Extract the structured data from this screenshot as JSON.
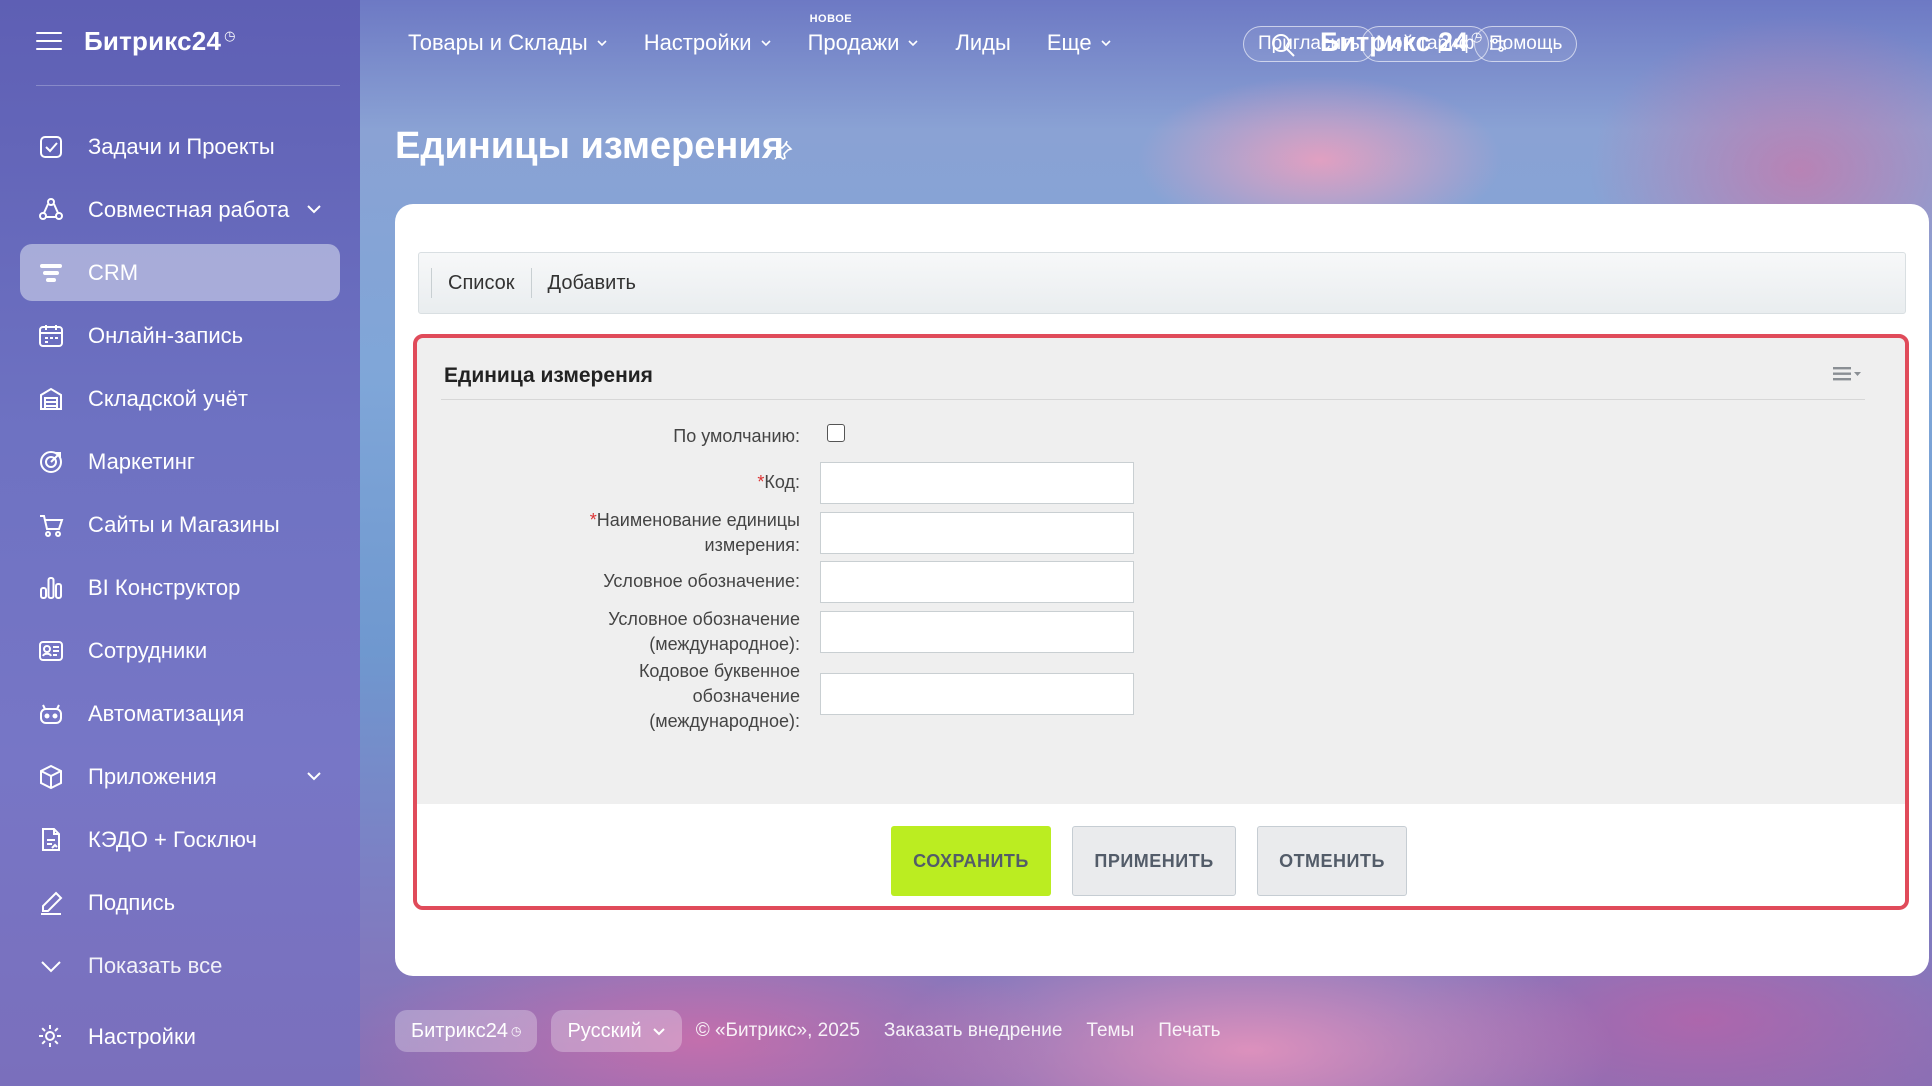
{
  "sidebar": {
    "brand": "Битрикс24",
    "items": [
      {
        "label": "Задачи и Проекты",
        "icon": "checkbox-icon",
        "active": false,
        "chevron": false
      },
      {
        "label": "Совместная работа",
        "icon": "collaboration-icon",
        "active": false,
        "chevron": true
      },
      {
        "label": "CRM",
        "icon": "crm-filter-icon",
        "active": true,
        "chevron": false
      },
      {
        "label": "Онлайн-запись",
        "icon": "calendar-icon",
        "active": false,
        "chevron": false
      },
      {
        "label": "Складской учёт",
        "icon": "warehouse-icon",
        "active": false,
        "chevron": false
      },
      {
        "label": "Маркетинг",
        "icon": "target-icon",
        "active": false,
        "chevron": false
      },
      {
        "label": "Сайты и Магазины",
        "icon": "cart-icon",
        "active": false,
        "chevron": false
      },
      {
        "label": "BI Конструктор",
        "icon": "bar-chart-icon",
        "active": false,
        "chevron": false
      },
      {
        "label": "Сотрудники",
        "icon": "id-card-icon",
        "active": false,
        "chevron": false
      },
      {
        "label": "Автоматизация",
        "icon": "robot-icon",
        "active": false,
        "chevron": false
      },
      {
        "label": "Приложения",
        "icon": "cube-icon",
        "active": false,
        "chevron": true
      },
      {
        "label": "КЭДО + Госключ",
        "icon": "document-sign-icon",
        "active": false,
        "chevron": false
      },
      {
        "label": "Подпись",
        "icon": "pen-icon",
        "active": false,
        "chevron": false
      },
      {
        "label": "Показать все",
        "icon": "chevron-down-icon",
        "active": false,
        "chevron": false
      }
    ],
    "settings_label": "Настройки"
  },
  "topbar": {
    "nav": [
      {
        "label": "Товары и Склады",
        "caret": true,
        "badge": ""
      },
      {
        "label": "Настройки",
        "caret": true,
        "badge": ""
      },
      {
        "label": "Продажи",
        "caret": true,
        "badge": "НОВОЕ"
      },
      {
        "label": "Лиды",
        "caret": false,
        "badge": ""
      },
      {
        "label": "Еще",
        "caret": true,
        "badge": ""
      }
    ],
    "brand": "Битрикс 24",
    "invite_label": "Пригласить",
    "tariff_label": "Мой тариф",
    "help_label": "Помощь"
  },
  "page": {
    "title": "Единицы измерения"
  },
  "tabs": [
    "Список",
    "Добавить"
  ],
  "form": {
    "title": "Единица измерения",
    "fields": {
      "default_label": "По умолчанию:",
      "code_label": "Код:",
      "name_label_1": "Наименование единицы",
      "name_label_2": "измерения:",
      "symbol_label": "Условное обозначение:",
      "intl_symbol_label_1": "Условное обозначение",
      "intl_symbol_label_2": "(международное):",
      "letter_code_label_1": "Кодовое буквенное",
      "letter_code_label_2": "обозначение",
      "letter_code_label_3": "(международное):",
      "code_value": "",
      "name_value": "",
      "symbol_value": "",
      "intl_symbol_value": "",
      "letter_code_value": "",
      "default_checked": false
    },
    "buttons": {
      "save": "СОХРАНИТЬ",
      "apply": "ПРИМЕНИТЬ",
      "cancel": "ОТМЕНИТЬ"
    }
  },
  "footer": {
    "brand": "Битрикс24",
    "language": "Русский",
    "copyright": "© «Битрикс», 2025",
    "links": [
      "Заказать внедрение",
      "Темы",
      "Печать"
    ]
  },
  "colors": {
    "save_button": "#bbed21",
    "highlight_border": "#e04b5a",
    "required_mark": "#dd3333"
  }
}
